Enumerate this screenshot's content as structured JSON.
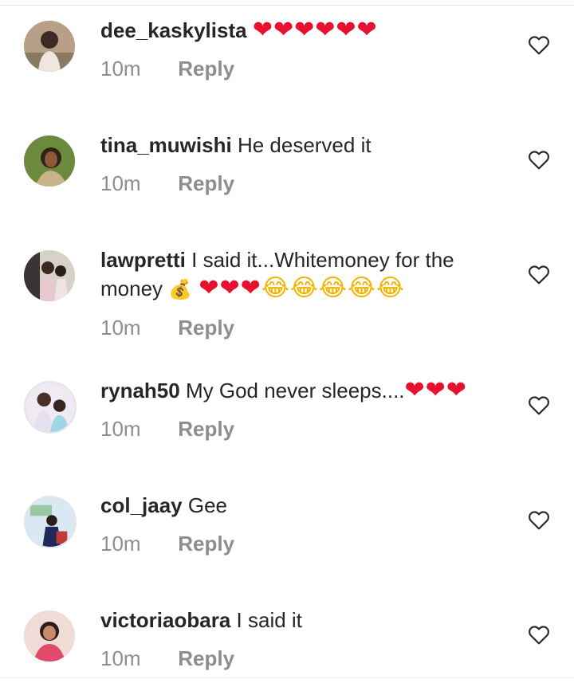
{
  "comments": [
    {
      "username": "dee_kaskylista",
      "text": "",
      "emoji": "❤❤❤❤❤❤",
      "time": "10m",
      "reply": "Reply",
      "avatar_colors": [
        "#caa58a",
        "#3c2a24",
        "#efe7dd"
      ]
    },
    {
      "username": "tina_muwishi",
      "text": "He deserved it",
      "emoji": "",
      "time": "10m",
      "reply": "Reply",
      "avatar_colors": [
        "#6b8a3d",
        "#2e2216",
        "#c9b38a"
      ]
    },
    {
      "username": "lawpretti",
      "text": "I said it...Whitemoney for the",
      "text2": "money",
      "emoji_bag": "💰",
      "emoji_hearts": "❤❤❤",
      "emoji_laugh": "😂😂😂😂😂",
      "time": "10m",
      "reply": "Reply",
      "avatar_colors": [
        "#e7c7d0",
        "#3a3438",
        "#f1e2e6"
      ]
    },
    {
      "username": "rynah50",
      "text": "My God never sleeps....",
      "emoji": "❤❤❤",
      "time": "10m",
      "reply": "Reply",
      "avatar_colors": [
        "#e7e0f0",
        "#4a2e2a",
        "#9fd6e6"
      ]
    },
    {
      "username": "col_jaay",
      "text": "Gee",
      "emoji": "",
      "time": "10m",
      "reply": "Reply",
      "avatar_colors": [
        "#d9e8f3",
        "#1f2a5a",
        "#9ac7a4"
      ]
    },
    {
      "username": "victoriaobara",
      "text": "I said it",
      "emoji": "",
      "time": "10m",
      "reply": "Reply",
      "avatar_colors": [
        "#f0dcd6",
        "#e14a6a",
        "#2a1c18"
      ]
    }
  ],
  "icons": {
    "like": "heart-outline-icon"
  },
  "colors": {
    "text": "#262626",
    "muted": "#8e8e8e",
    "heart_red": "#e8102f"
  }
}
